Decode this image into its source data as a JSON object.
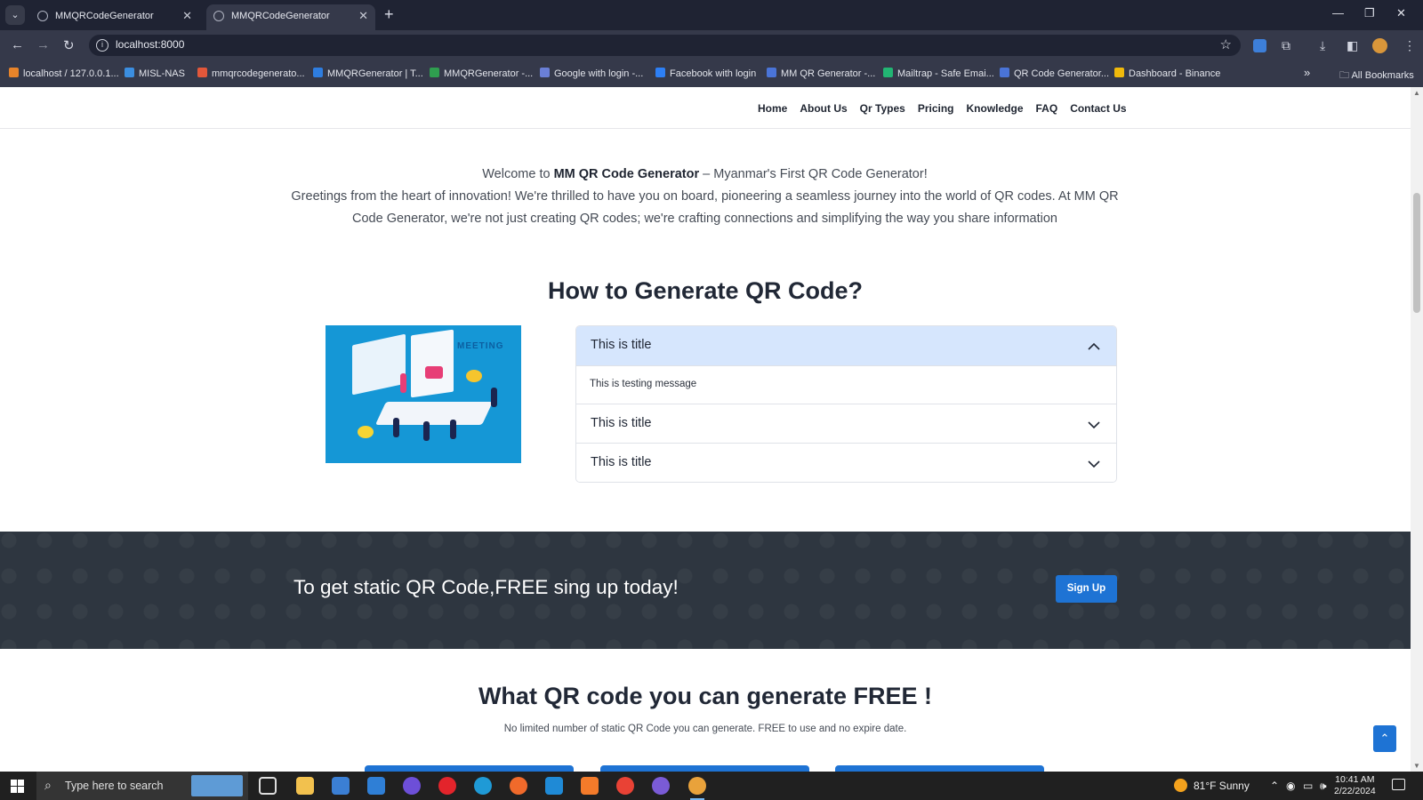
{
  "browser": {
    "tabs": [
      {
        "title": "MMQRCodeGenerator"
      },
      {
        "title": "MMQRCodeGenerator"
      }
    ],
    "url": "localhost:8000",
    "bookmarks": [
      {
        "label": "localhost / 127.0.0.1...",
        "color": "#e8842a"
      },
      {
        "label": "MISL-NAS",
        "color": "#3b8ee0"
      },
      {
        "label": "mmqrcodegenerato...",
        "color": "#e2573a"
      },
      {
        "label": "MMQRGenerator | T...",
        "color": "#2e7de0"
      },
      {
        "label": "MMQRGenerator -...",
        "color": "#2f9e4f"
      },
      {
        "label": "Google with login -...",
        "color": "#6a7fd6"
      },
      {
        "label": "Facebook with login",
        "color": "#2d7ff5"
      },
      {
        "label": "MM QR Generator -...",
        "color": "#4a74d8"
      },
      {
        "label": "Mailtrap - Safe Emai...",
        "color": "#22b573"
      },
      {
        "label": "QR Code Generator...",
        "color": "#4a74d8"
      },
      {
        "label": "Dashboard - Binance",
        "color": "#f0b90b"
      }
    ],
    "more_symbol": "»",
    "all_bookmarks": "All Bookmarks"
  },
  "site": {
    "nav": [
      "Home",
      "About Us",
      "Qr Types",
      "Pricing",
      "Knowledge",
      "FAQ",
      "Contact Us"
    ],
    "intro": {
      "line1_pre": "Welcome to ",
      "line1_bold": "MM QR Code Generator",
      "line1_post": " – Myanmar's First QR Code Generator!",
      "line2": "Greetings from the heart of innovation! We're thrilled to have you on board, pioneering a seamless journey into the world of QR codes. At MM QR Code Generator, we're not just creating QR codes; we're crafting connections and simplifying the way you share information"
    },
    "how_title": "How to Generate QR Code?",
    "illustration_word": "MEETING",
    "accordion": [
      {
        "title": "This is title",
        "expanded": true,
        "body": "This is testing message"
      },
      {
        "title": "This is title",
        "expanded": false
      },
      {
        "title": "This is title",
        "expanded": false
      }
    ],
    "cta": {
      "text": "To get static QR Code,FREE sing up today!",
      "button": "Sign Up"
    },
    "free_title": "What QR code you can generate FREE !",
    "free_sub": "No limited number of static QR Code you can generate. FREE to use and no expire date.",
    "accent": "#1e73d4"
  },
  "taskbar": {
    "search_placeholder": "Type here to search",
    "weather": "81°F  Sunny",
    "time": "10:41 AM",
    "date": "2/22/2024"
  }
}
